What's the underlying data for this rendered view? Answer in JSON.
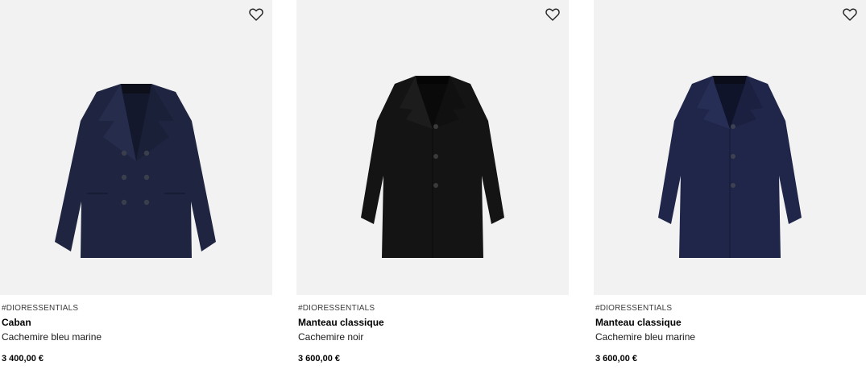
{
  "products": [
    {
      "hashtag": "#DIORESSENTIALS",
      "name": "Caban",
      "material": "Cachemire bleu marine",
      "price": "3 400,00 €",
      "coat_color": "#1f2541",
      "style": "peacoat"
    },
    {
      "hashtag": "#DIORESSENTIALS",
      "name": "Manteau classique",
      "material": "Cachemire noir",
      "price": "3 600,00 €",
      "coat_color": "#141414",
      "style": "overcoat"
    },
    {
      "hashtag": "#DIORESSENTIALS",
      "name": "Manteau classique",
      "material": "Cachemire bleu marine",
      "price": "3 600,00 €",
      "coat_color": "#20264a",
      "style": "overcoat"
    }
  ],
  "icons": {
    "wishlist": "heart-outline-icon"
  }
}
